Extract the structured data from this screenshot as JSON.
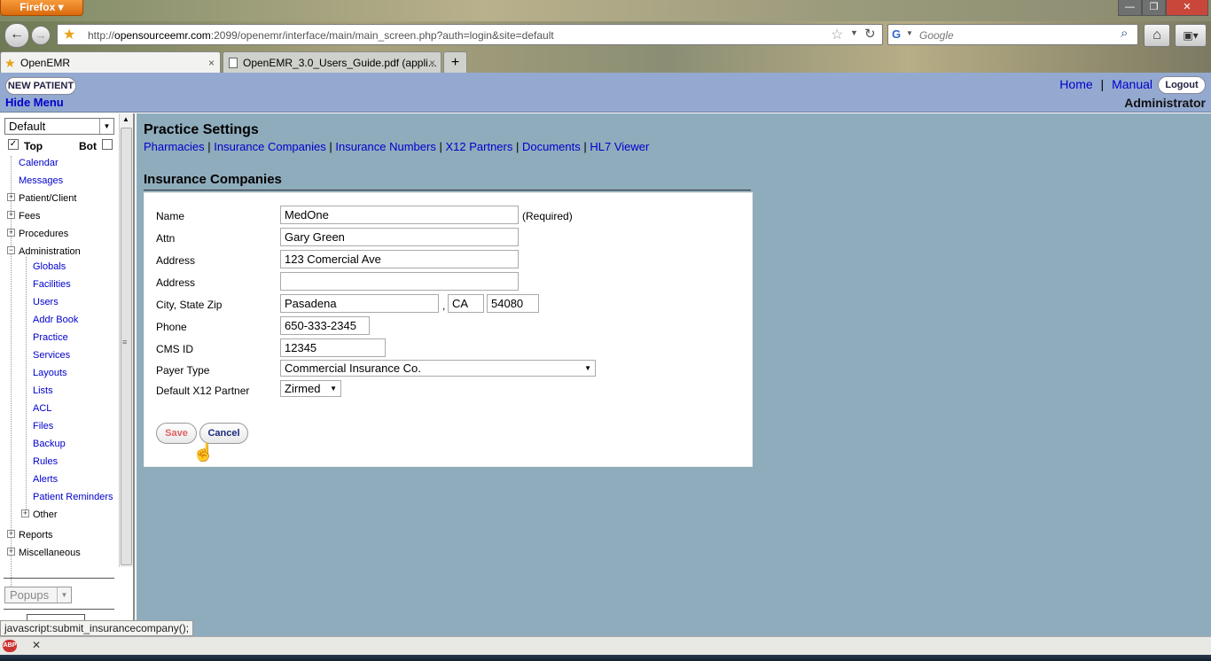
{
  "browser": {
    "menu_label": "Firefox",
    "url_host": "opensourceemr.com",
    "url_prefix": "http://",
    "url_rest": ":2099/openemr/interface/main/main_screen.php?auth=login&site=default",
    "search_placeholder": "Google",
    "tabs": [
      {
        "label": "OpenEMR",
        "close": "×"
      },
      {
        "label": "OpenEMR_3.0_Users_Guide.pdf (appli...",
        "close": "×"
      }
    ],
    "new_tab": "+",
    "status_text": "javascript:submit_insurancecompany();"
  },
  "header": {
    "new_patient": "NEW PATIENT",
    "hide_menu": "Hide Menu",
    "home": "Home",
    "separator": "|",
    "manual": "Manual",
    "logout": "Logout",
    "user": "Administrator"
  },
  "sidebar": {
    "select_value": "Default",
    "top_label": "Top",
    "bot_label": "Bot",
    "items": {
      "calendar": "Calendar",
      "messages": "Messages",
      "patient_client": "Patient/Client",
      "fees": "Fees",
      "procedures": "Procedures",
      "administration": "Administration",
      "globals": "Globals",
      "facilities": "Facilities",
      "users": "Users",
      "addr_book": "Addr Book",
      "practice": "Practice",
      "services": "Services",
      "layouts": "Layouts",
      "lists": "Lists",
      "acl": "ACL",
      "files": "Files",
      "backup": "Backup",
      "rules": "Rules",
      "alerts": "Alerts",
      "patient_reminders": "Patient Reminders",
      "other": "Other",
      "reports": "Reports",
      "miscellaneous": "Miscellaneous"
    },
    "popups": "Popups"
  },
  "practice": {
    "title": "Practice Settings",
    "links": [
      "Pharmacies",
      "Insurance Companies",
      "Insurance Numbers",
      "X12 Partners",
      "Documents",
      "HL7 Viewer"
    ],
    "sep": "|"
  },
  "form": {
    "title": "Insurance Companies",
    "labels": {
      "name": "Name",
      "attn": "Attn",
      "address1": "Address",
      "address2": "Address",
      "city_state_zip": "City, State Zip",
      "phone": "Phone",
      "cms_id": "CMS ID",
      "payer_type": "Payer Type",
      "x12": "Default X12 Partner"
    },
    "values": {
      "name": "MedOne",
      "attn": "Gary Green",
      "address1": "123 Comercial Ave",
      "address2": "",
      "city": "Pasadena",
      "comma": ",",
      "state": "CA",
      "zip": "54080",
      "phone": "650-333-2345",
      "cms_id": "12345",
      "payer_type": "Commercial Insurance Co.",
      "x12": "Zirmed"
    },
    "required_note": "(Required)",
    "save": "Save",
    "cancel": "Cancel"
  }
}
